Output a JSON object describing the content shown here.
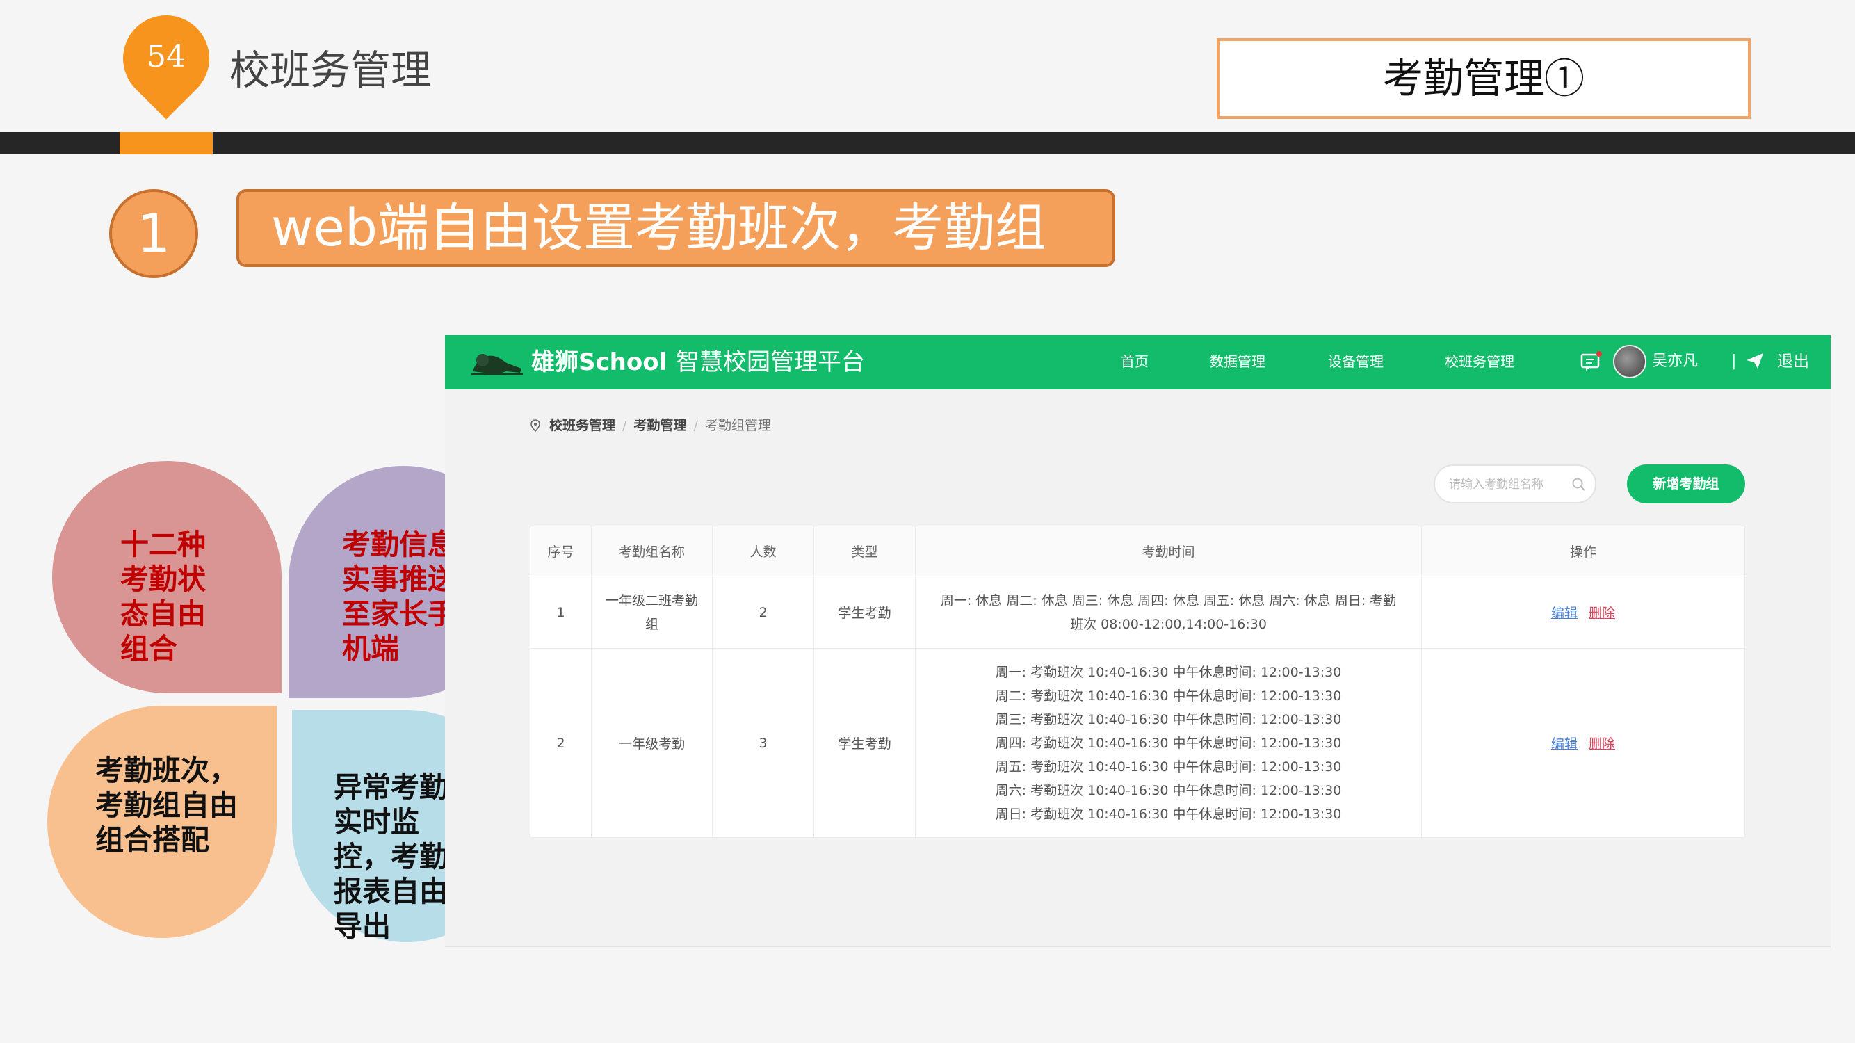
{
  "header": {
    "page_number": "54",
    "title": "校班务管理",
    "section_box": "考勤管理①",
    "colors": {
      "accent": "#f7941d",
      "dark_bar": "#262626"
    }
  },
  "heading": {
    "number": "1",
    "text": "web端自由设置考勤班次，考勤组"
  },
  "petals": [
    {
      "text": "十二种考勤状态自由组合",
      "color": "#d99594",
      "text_color": "#c00000"
    },
    {
      "text": "考勤信息实事推送至家长手机端",
      "color": "#b4a6c9",
      "text_color": "#c00000"
    },
    {
      "text": "考勤班次，考勤组自由组合搭配",
      "color": "#f9c08f",
      "text_color": "#111111"
    },
    {
      "text": "异常考勤实时监控，考勤报表自由导出",
      "color": "#b7dde8",
      "text_color": "#111111"
    }
  ],
  "app": {
    "brand": "雄狮School",
    "platform": "智慧校园管理平台",
    "nav": [
      "首页",
      "数据管理",
      "设备管理",
      "校班务管理"
    ],
    "user": "吴亦凡",
    "separator": "|",
    "logout": "退出",
    "breadcrumb": [
      "校班务管理",
      "考勤管理",
      "考勤组管理"
    ],
    "breadcrumb_sep": "/",
    "search_placeholder": "请输入考勤组名称",
    "add_button": "新增考勤组",
    "theme_color": "#12bc6a",
    "table": {
      "headers": [
        "序号",
        "考勤组名称",
        "人数",
        "类型",
        "考勤时间",
        "操作"
      ],
      "rows": [
        {
          "index": "1",
          "name": "一年级二班考勤组",
          "count": "2",
          "type": "学生考勤",
          "time": [
            "周一: 休息 周二: 休息 周三: 休息 周四: 休息 周五: 休息 周六: 休息 周日: 考勤",
            "班次 08:00-12:00,14:00-16:30"
          ],
          "edit": "编辑",
          "delete": "删除"
        },
        {
          "index": "2",
          "name": "一年级考勤",
          "count": "3",
          "type": "学生考勤",
          "time": [
            "周一: 考勤班次 10:40-16:30 中午休息时间: 12:00-13:30",
            "周二: 考勤班次 10:40-16:30 中午休息时间: 12:00-13:30",
            "周三: 考勤班次 10:40-16:30 中午休息时间: 12:00-13:30",
            "周四: 考勤班次 10:40-16:30 中午休息时间: 12:00-13:30",
            "周五: 考勤班次 10:40-16:30 中午休息时间: 12:00-13:30",
            "周六: 考勤班次 10:40-16:30 中午休息时间: 12:00-13:30",
            "周日: 考勤班次 10:40-16:30 中午休息时间: 12:00-13:30"
          ],
          "edit": "编辑",
          "delete": "删除"
        }
      ]
    }
  }
}
